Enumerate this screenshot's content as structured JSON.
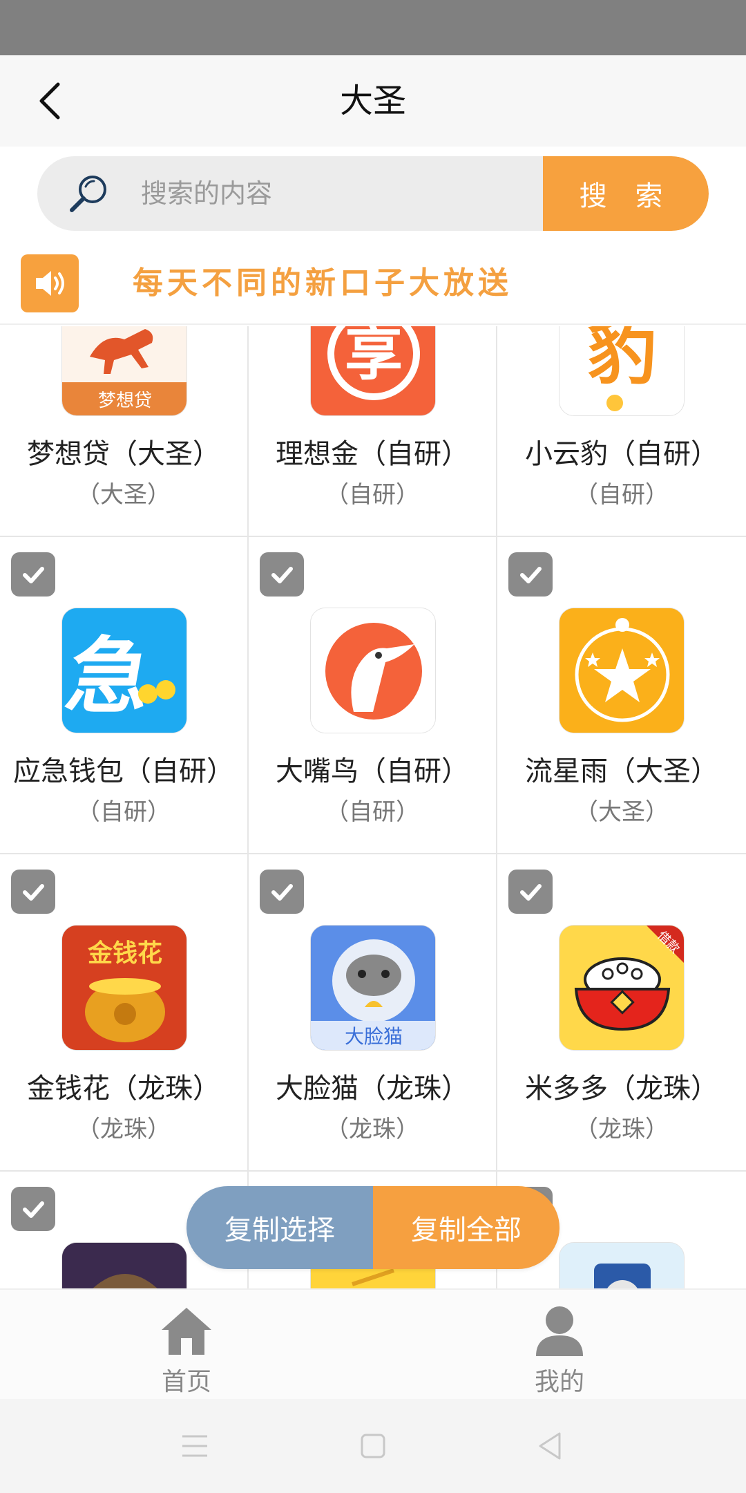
{
  "header": {
    "title": "大圣"
  },
  "search": {
    "placeholder": "搜索的内容",
    "button_label": "搜 索"
  },
  "notice": {
    "text": "每天不同的新口子大放送"
  },
  "apps": [
    {
      "name": "梦想贷（大圣）",
      "sub": "（大圣）",
      "icon": "horse-dream-loan-icon",
      "icon_text": "梦想贷",
      "checked": true
    },
    {
      "name": "理想金（自研）",
      "sub": "（自研）",
      "icon": "xiang-character-icon",
      "icon_text": "享",
      "checked": true
    },
    {
      "name": "小云豹（自研）",
      "sub": "（自研）",
      "icon": "bao-character-icon",
      "icon_text": "豹",
      "checked": true
    },
    {
      "name": "应急钱包（自研）",
      "sub": "（自研）",
      "icon": "ji-urgent-icon",
      "icon_text": "急",
      "checked": true
    },
    {
      "name": "大嘴鸟（自研）",
      "sub": "（自研）",
      "icon": "toucan-bird-icon",
      "icon_text": "",
      "checked": true
    },
    {
      "name": "流星雨（大圣）",
      "sub": "（大圣）",
      "icon": "star-person-icon",
      "icon_text": "",
      "checked": true
    },
    {
      "name": "金钱花（龙珠）",
      "sub": "（龙珠）",
      "icon": "money-pot-icon",
      "icon_text": "金钱花",
      "checked": true
    },
    {
      "name": "大脸猫（龙珠）",
      "sub": "（龙珠）",
      "icon": "big-face-cat-icon",
      "icon_text": "大脸猫",
      "checked": true
    },
    {
      "name": "米多多（龙珠）",
      "sub": "（龙珠）",
      "icon": "rice-bowl-icon",
      "icon_text": "借款",
      "checked": true
    },
    {
      "name": "",
      "sub": "",
      "icon": "character-face-icon",
      "icon_text": "",
      "checked": true
    },
    {
      "name": "",
      "sub": "",
      "icon": "yellow-app-icon",
      "icon_text": "",
      "checked": true
    },
    {
      "name": "",
      "sub": "",
      "icon": "train-app-icon",
      "icon_text": "",
      "checked": true
    }
  ],
  "actions": {
    "copy_selected": "复制选择",
    "copy_all": "复制全部"
  },
  "tabs": [
    {
      "label": "首页",
      "icon": "home-icon"
    },
    {
      "label": "我的",
      "icon": "user-icon"
    }
  ],
  "colors": {
    "accent": "#f7a13e",
    "copy_selected_bg": "#7f9fc0",
    "check_bg": "#8a8a8a"
  }
}
